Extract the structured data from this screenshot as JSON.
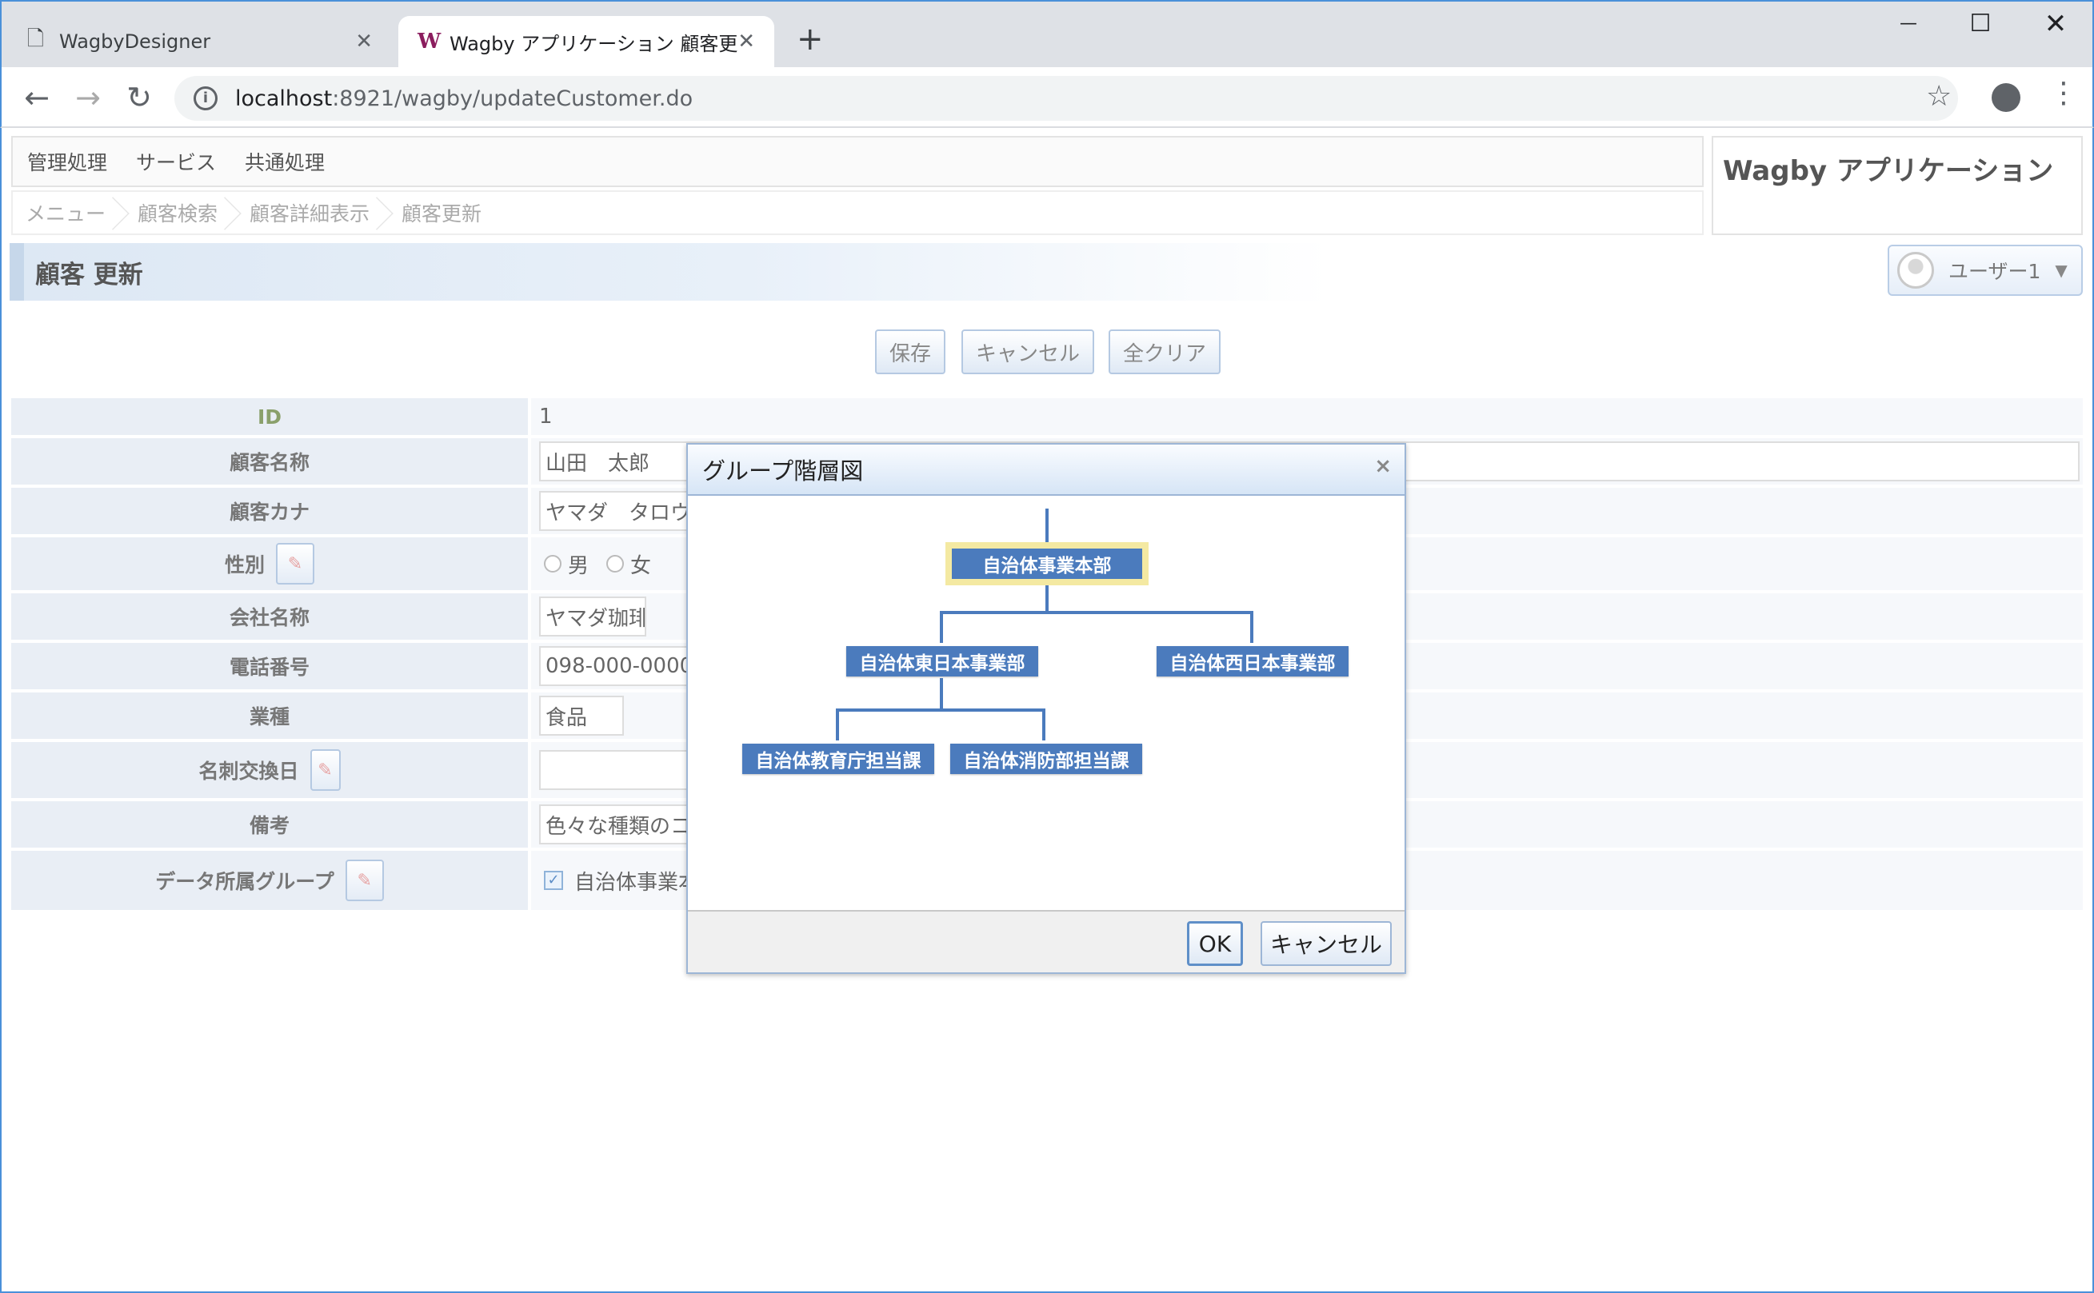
{
  "browser": {
    "tabs": [
      {
        "title": "WagbyDesigner"
      },
      {
        "title": "Wagby アプリケーション 顧客更新"
      }
    ],
    "new_tab_glyph": "+",
    "window_controls": {
      "minimize": "—",
      "maximize": "☐",
      "close": "✕"
    },
    "address": {
      "host": "localhost",
      "path": ":8921/wagby/updateCustomer.do"
    }
  },
  "menubar": {
    "items": [
      "管理処理",
      "サービス",
      "共通処理"
    ]
  },
  "breadcrumb": [
    "メニュー",
    "顧客検索",
    "顧客詳細表示",
    "顧客更新"
  ],
  "app_title": "Wagby アプリケーション",
  "page_title": "顧客 更新",
  "user": {
    "name": "ユーザー1"
  },
  "actions": {
    "save": "保存",
    "cancel": "キャンセル",
    "clear_all": "全クリア"
  },
  "form": {
    "id": {
      "label": "ID",
      "value": "1"
    },
    "name": {
      "label": "顧客名称",
      "value": "山田　太郎"
    },
    "kana": {
      "label": "顧客カナ",
      "value": "ヤマダ　タロウ"
    },
    "gender": {
      "label": "性別",
      "options": [
        "男",
        "女"
      ]
    },
    "company": {
      "label": "会社名称",
      "value": "ヤマダ珈琲"
    },
    "phone": {
      "label": "電話番号",
      "value": "098-000-0000"
    },
    "industry": {
      "label": "業種",
      "value": "食品"
    },
    "card_date": {
      "label": "名刺交換日",
      "value": ""
    },
    "note": {
      "label": "備考",
      "value": "色々な種類のコ"
    },
    "group": {
      "label": "データ所属グループ",
      "value": "自治体事業本部",
      "checked": true
    }
  },
  "dialog": {
    "title": "グループ階層図",
    "close_glyph": "×",
    "ok": "OK",
    "cancel": "キャンセル",
    "tree": {
      "root": "自治体事業本部",
      "east": "自治体東日本事業部",
      "west": "自治体西日本事業部",
      "edu": "自治体教育庁担当課",
      "fire": "自治体消防部担当課",
      "selected": "自治体事業本部"
    }
  },
  "colors": {
    "node": "#4b7bbd",
    "selected_outline": "#f4e9a2",
    "accent": "#4a90d9"
  }
}
